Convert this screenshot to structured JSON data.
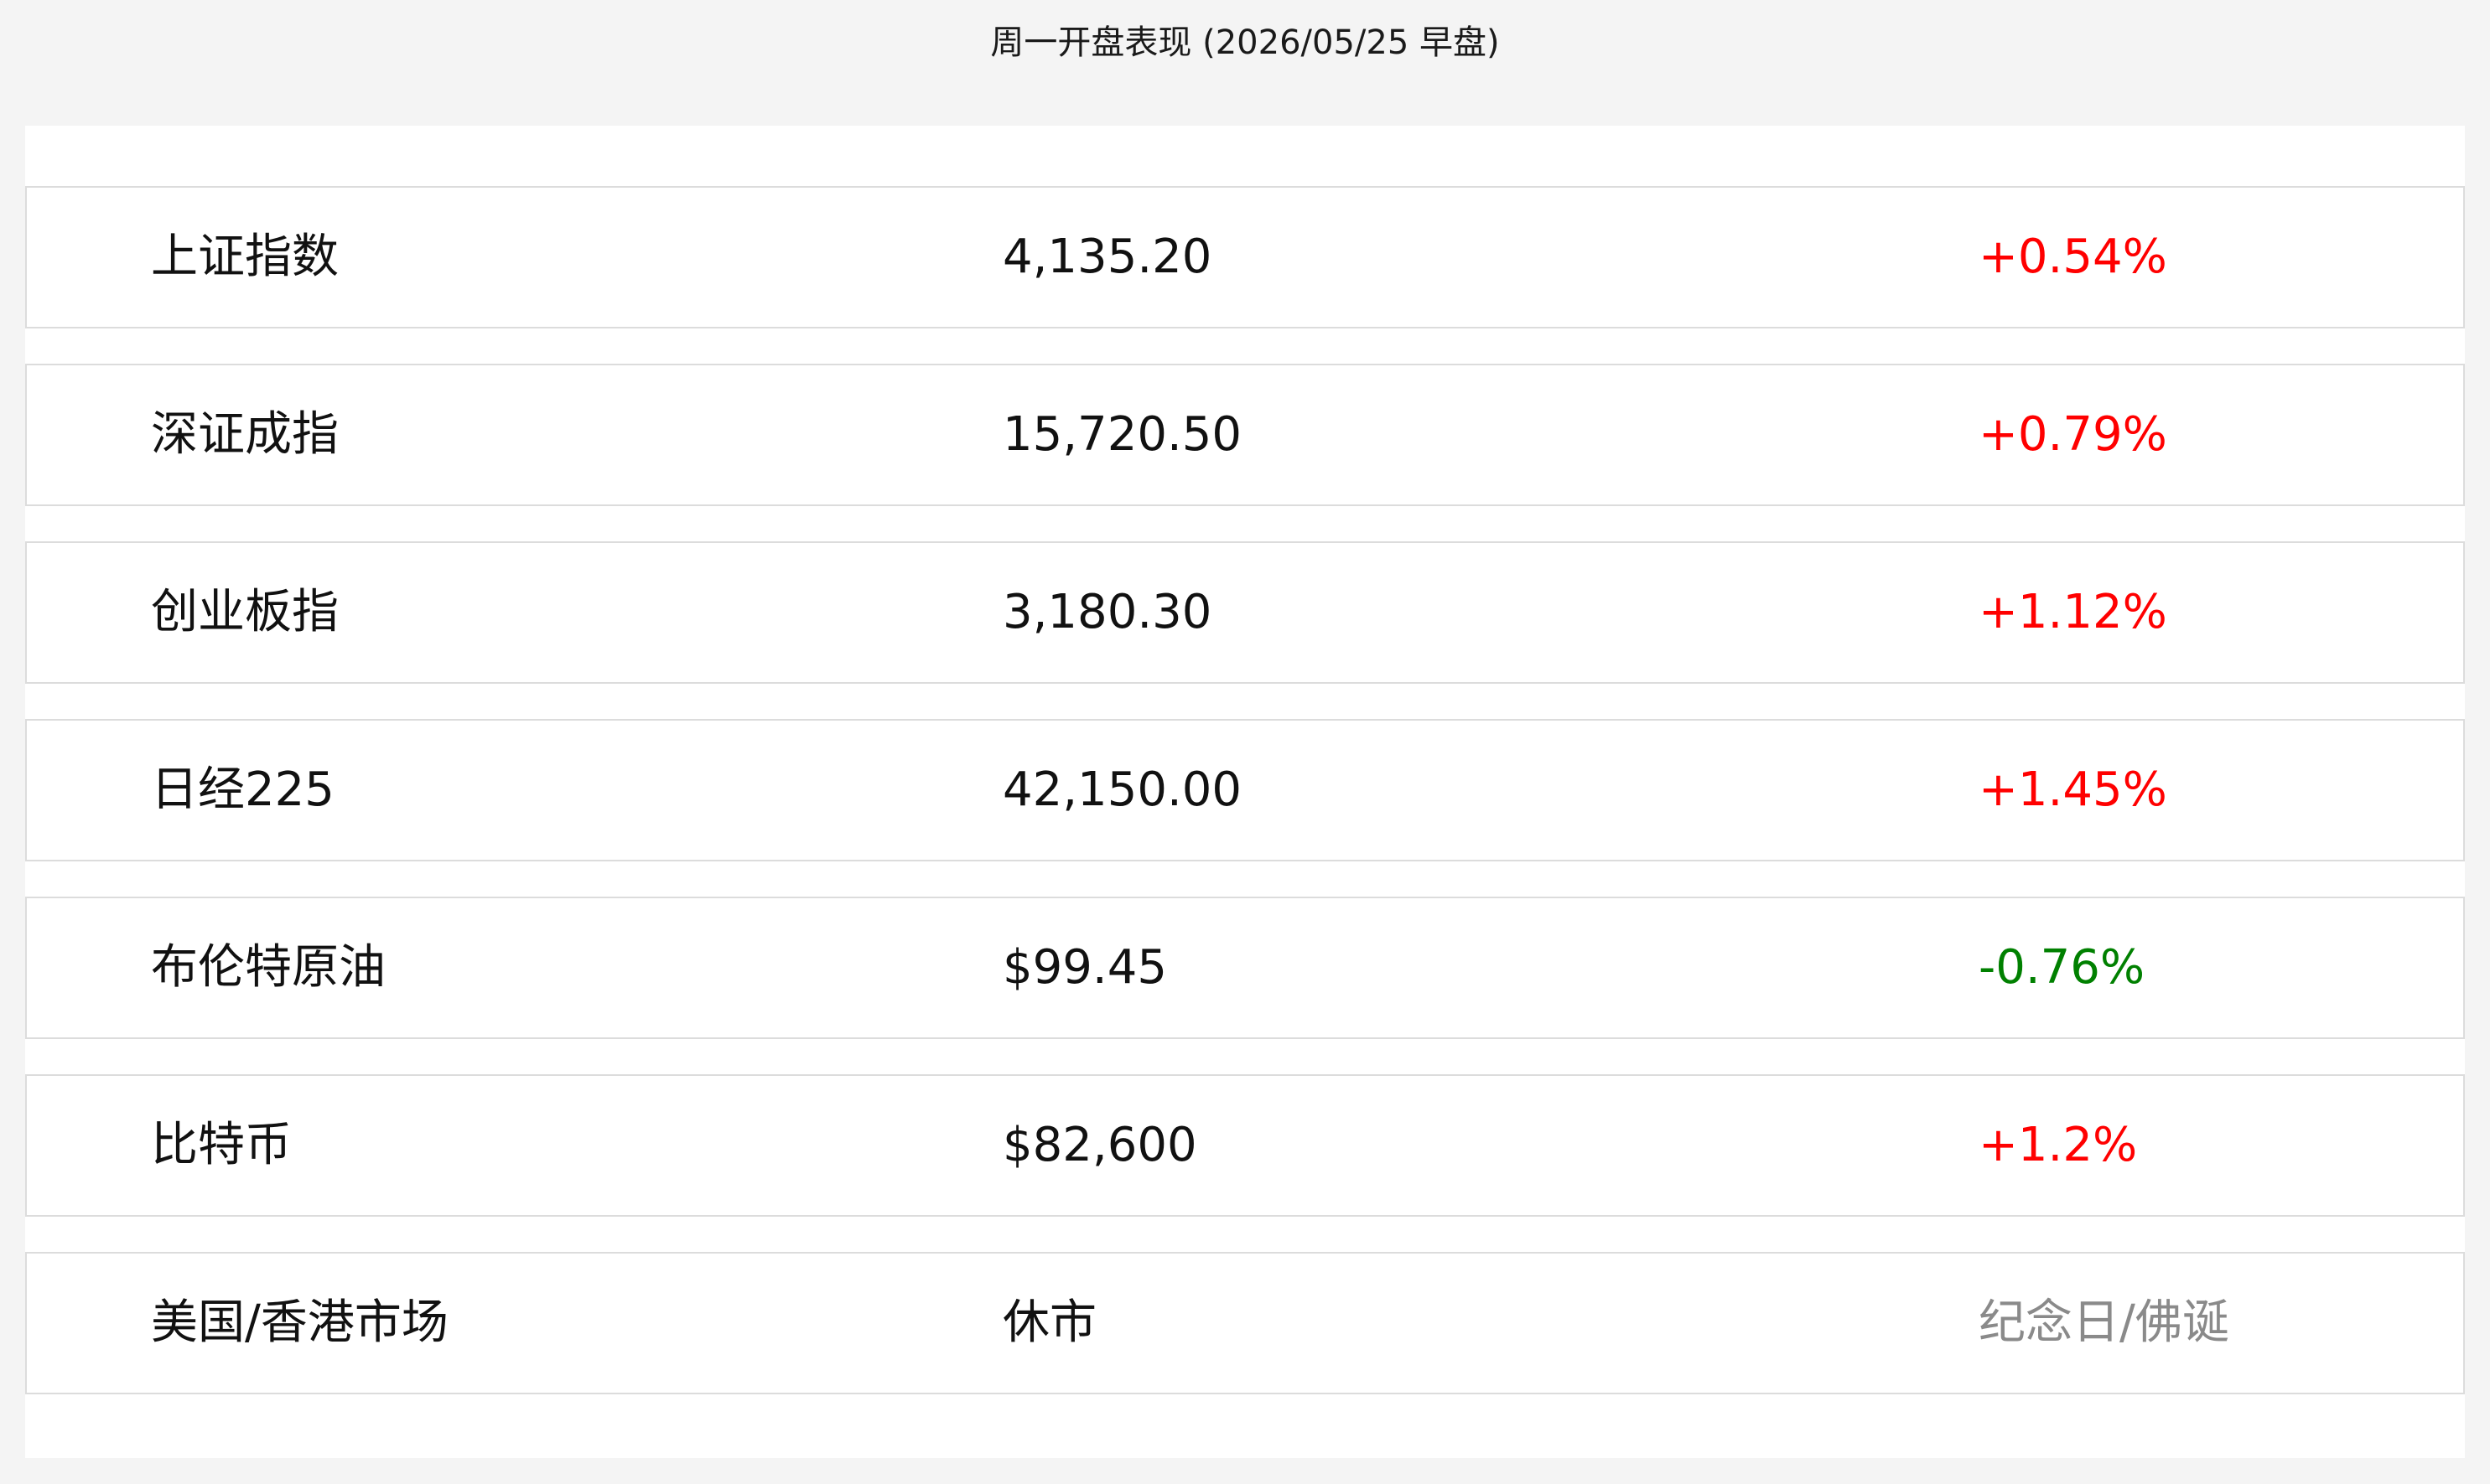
{
  "header": {
    "title": "周一开盘表现 (2026/05/25 早盘)"
  },
  "colors": {
    "up": "#ff0000",
    "down": "#008000",
    "closed": "#8a8a8a"
  },
  "rows": [
    {
      "name": "上证指数",
      "value": "4,135.20",
      "change": "+0.54%",
      "status": "up"
    },
    {
      "name": "深证成指",
      "value": "15,720.50",
      "change": "+0.79%",
      "status": "up"
    },
    {
      "name": "创业板指",
      "value": "3,180.30",
      "change": "+1.12%",
      "status": "up"
    },
    {
      "name": "日经225",
      "value": "42,150.00",
      "change": "+1.45%",
      "status": "up"
    },
    {
      "name": "布伦特原油",
      "value": "$99.45",
      "change": "-0.76%",
      "status": "down"
    },
    {
      "name": "比特币",
      "value": "$82,600",
      "change": "+1.2%",
      "status": "up"
    },
    {
      "name": "美国/香港市场",
      "value": "休市",
      "change": "纪念日/佛诞",
      "status": "closed"
    }
  ]
}
